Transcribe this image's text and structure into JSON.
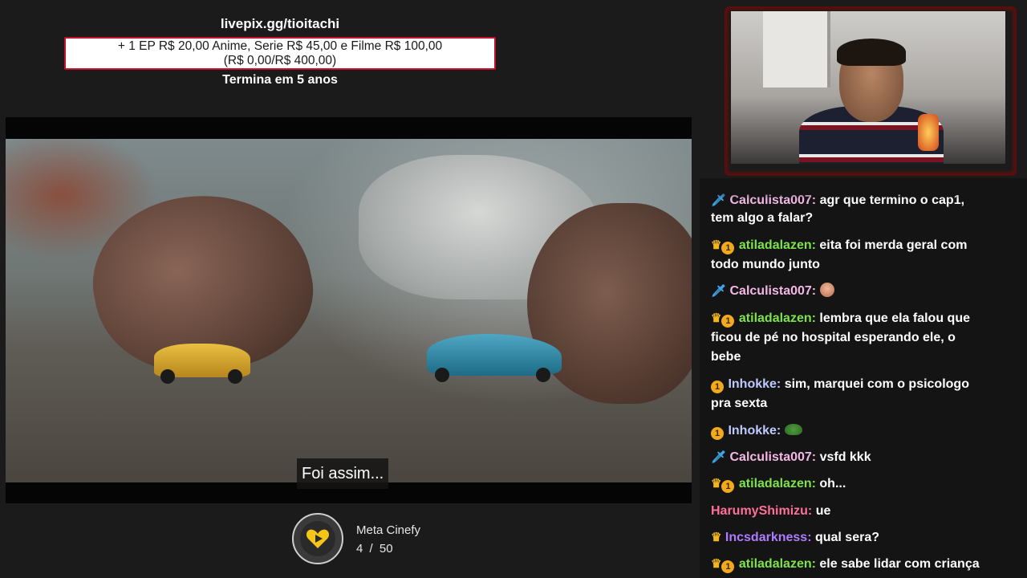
{
  "donation": {
    "url": "livepix.gg/tioitachi",
    "goal_line1": "+ 1 EP R$ 20,00 Anime, Serie R$ 45,00 e Filme R$ 100,00",
    "goal_line2": "(R$ 0,00/R$ 400,00)",
    "ends": "Termina em 5 anos"
  },
  "player": {
    "subtitle": "Foi assim..."
  },
  "goal_widget": {
    "label": "Meta Cinefy",
    "current": "4",
    "separator": "/",
    "target": "50",
    "icon": "heart-play-icon"
  },
  "chat": {
    "messages": [
      {
        "user": "Calculista007:",
        "text": "agr que termino o cap1,",
        "user_color": "#f4b8e6"
      },
      {
        "user": "",
        "text": "tem algo a falar?",
        "user_color": "#ffffff"
      },
      {
        "user": "atiladalazen:",
        "text": "eita foi merda geral com",
        "user_color": "#7ee34a"
      },
      {
        "user": "",
        "text": "todo mundo junto",
        "user_color": "#ffffff"
      },
      {
        "user": "Calculista007:",
        "text": "",
        "user_color": "#f4b8e6"
      },
      {
        "user": "atiladalazen:",
        "text": "lembra que ela falou que",
        "user_color": "#7ee34a"
      },
      {
        "user": "",
        "text": "ficou de pé no hospital esperando ele, o",
        "user_color": "#ffffff"
      },
      {
        "user": "",
        "text": "bebe",
        "user_color": "#ffffff"
      },
      {
        "user": "Inhokke:",
        "text": "sim, marquei com o psicologo",
        "user_color": "#bfc9ff"
      },
      {
        "user": "",
        "text": "pra sexta",
        "user_color": "#ffffff"
      },
      {
        "user": "Inhokke:",
        "text": "",
        "user_color": "#bfc9ff"
      },
      {
        "user": "Calculista007:",
        "text": "vsfd kkk",
        "user_color": "#f4b8e6"
      },
      {
        "user": "atiladalazen:",
        "text": "oh...",
        "user_color": "#7ee34a"
      },
      {
        "user": "HarumyShimizu:",
        "text": "ue",
        "user_color": "#ff6f9c"
      },
      {
        "user": "Incsdarkness:",
        "text": "qual sera?",
        "user_color": "#b07cff"
      },
      {
        "user": "atiladalazen:",
        "text": "ele sabe lidar com criança",
        "user_color": "#7ee34a"
      }
    ]
  },
  "colors": {
    "accent_red": "#c4122e",
    "crown_gold": "#f3b61e",
    "sword_blue": "#3fa6e8"
  }
}
